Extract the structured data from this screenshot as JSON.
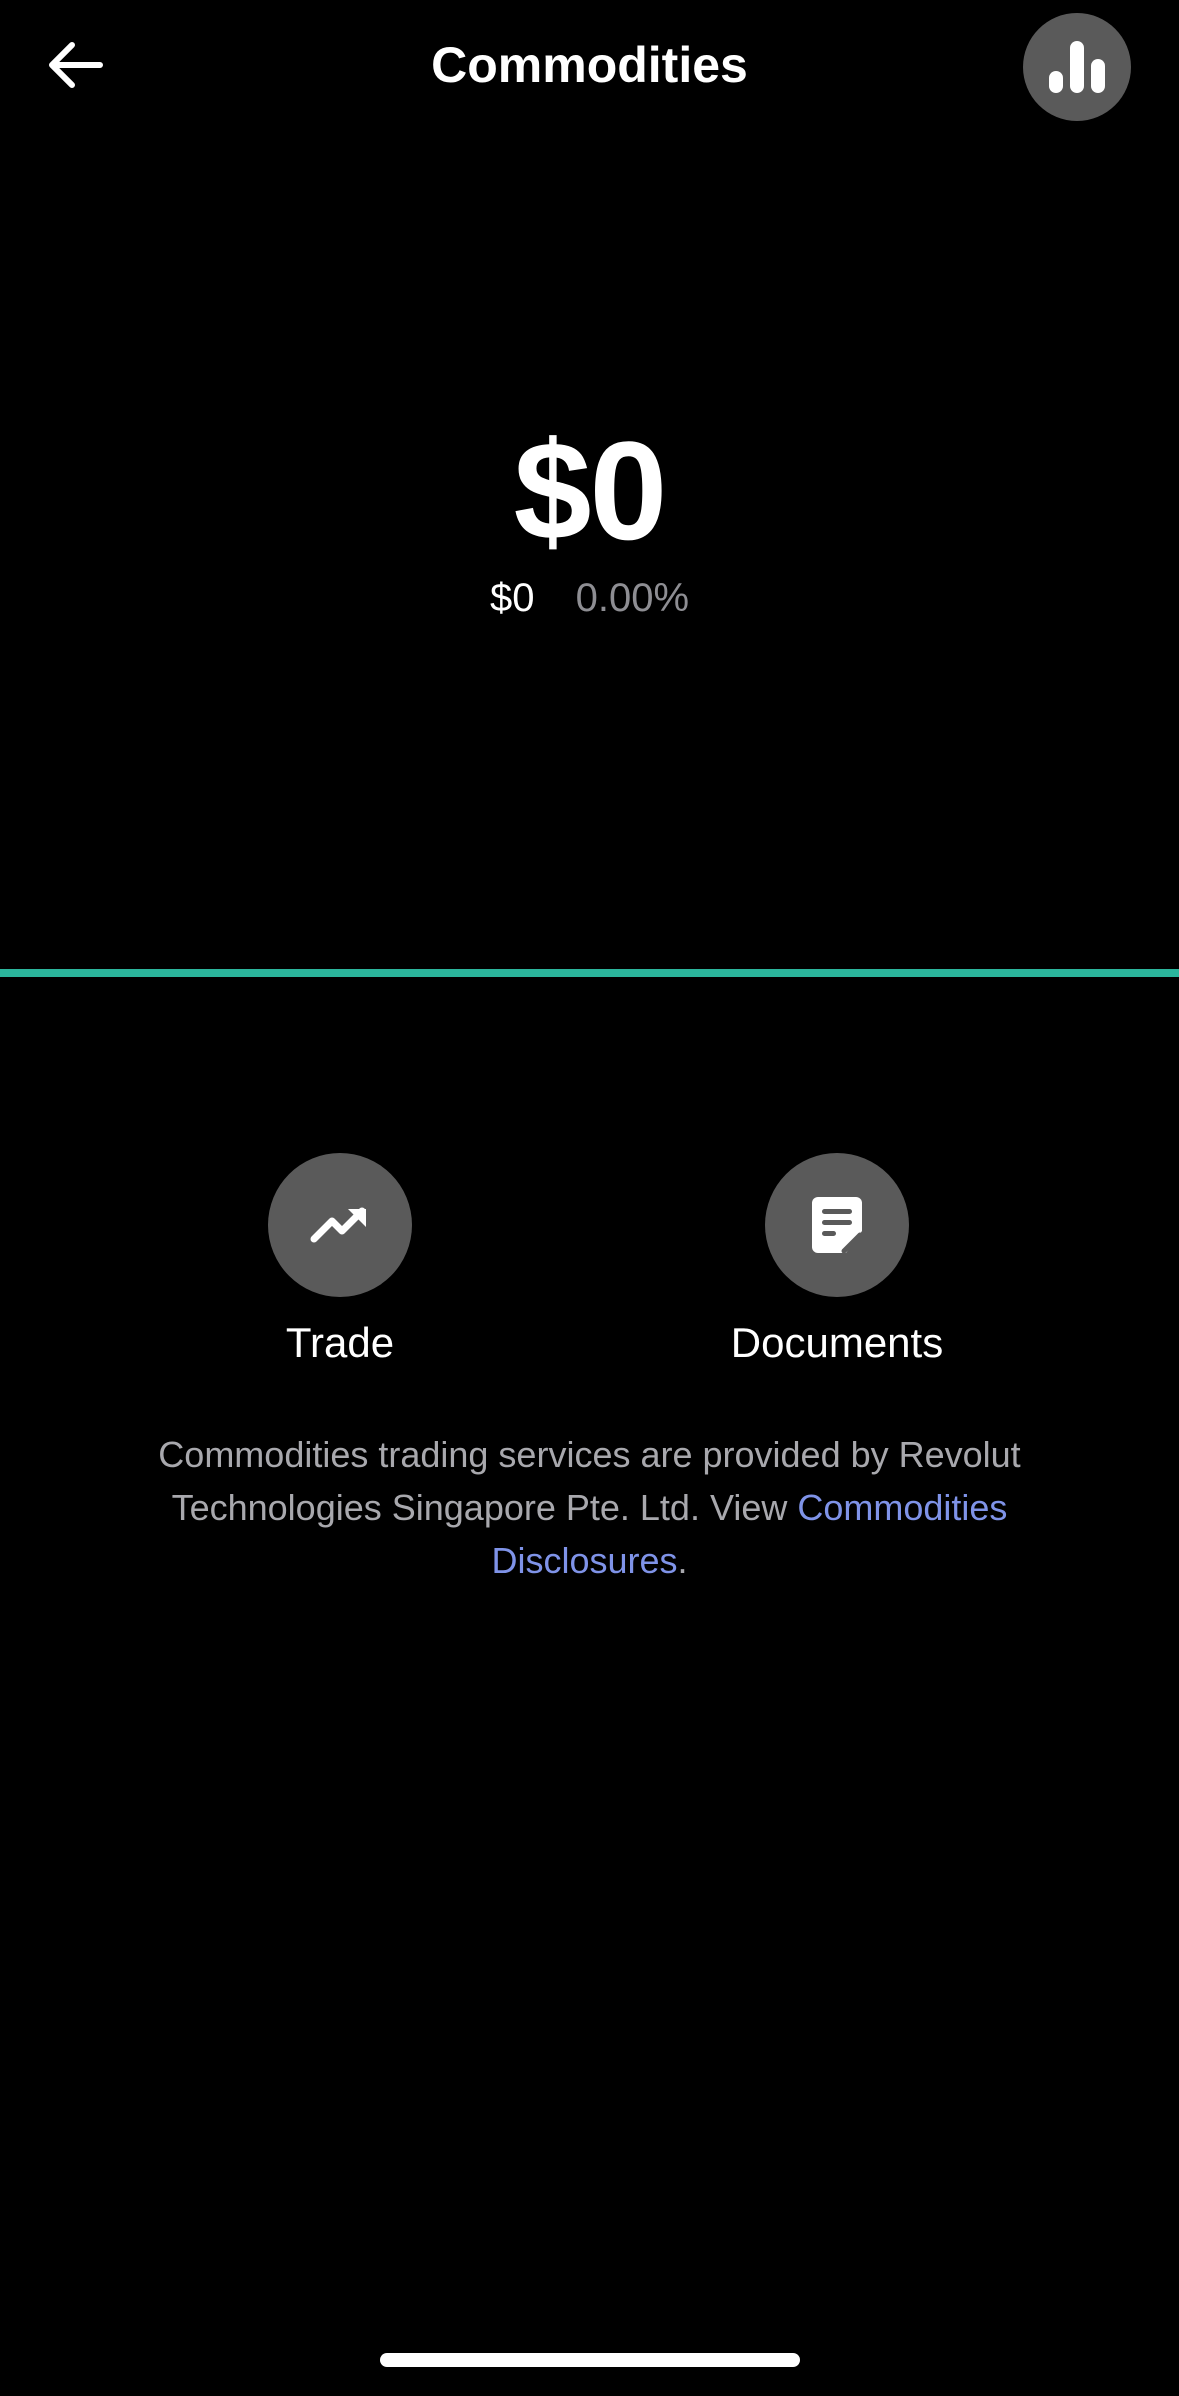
{
  "header": {
    "title": "Commodities",
    "back_icon": "arrow-left-icon",
    "analytics_icon": "bar-chart-icon"
  },
  "balance": {
    "amount": "$0",
    "change_amount": "$0",
    "change_percent": "0.00%"
  },
  "chart": {
    "line_color": "#2bb59c"
  },
  "actions": {
    "trade": {
      "label": "Trade",
      "icon": "trend-up-icon"
    },
    "documents": {
      "label": "Documents",
      "icon": "document-icon"
    }
  },
  "disclaimer": {
    "text": "Commodities trading services are provided by Revolut Technologies Singapore Pte. Ltd. View ",
    "link_text": "Commodities Disclosures",
    "trailing": "."
  },
  "colors": {
    "background": "#000000",
    "button_bg": "#5a5a5a",
    "link": "#7f93e8",
    "muted_text": "#a8a8ad"
  }
}
